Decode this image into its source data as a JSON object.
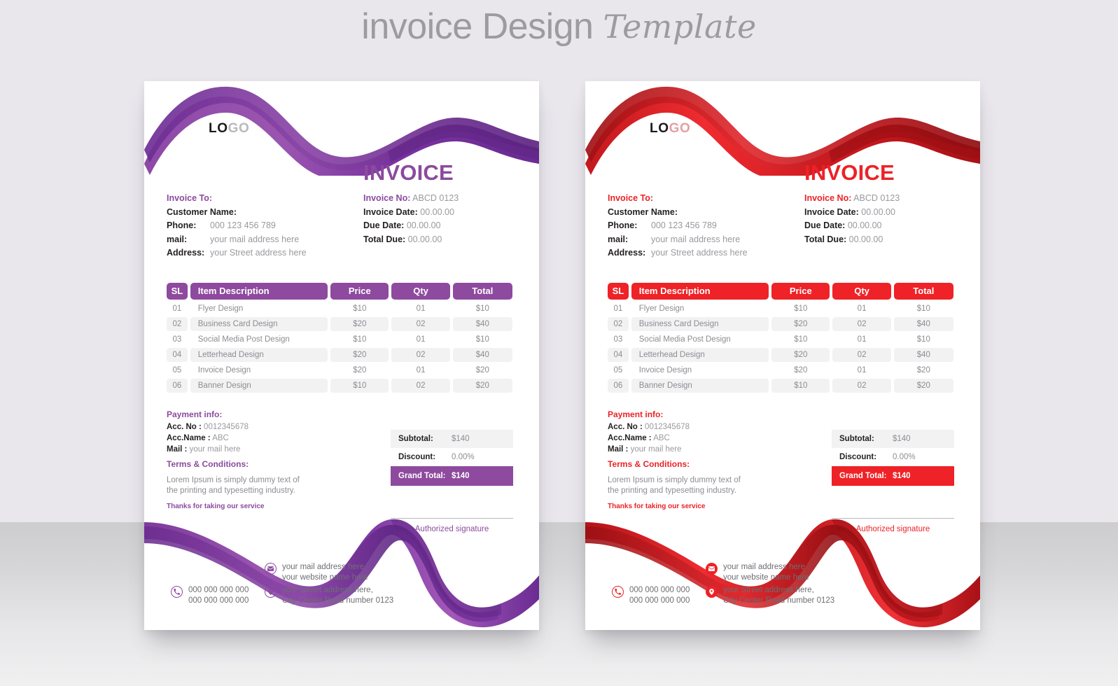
{
  "headline": {
    "main": "invoice Design",
    "script": "Template"
  },
  "colors": {
    "purple_accent": "#8b4a9e",
    "purple_dark": "#6b2d8f",
    "purple_light": "#a359b5",
    "red_accent": "#ec2227",
    "red_dark": "#b01217",
    "red_light": "#e8353b",
    "page_bg_top": "#e9e7ec",
    "page_bg_bottom": "#cdcdcf",
    "row_alt": "#f2f2f3",
    "muted_text": "#8d8d93",
    "dark_text": "#231f20"
  },
  "invoice": {
    "logo": {
      "part1": "LO",
      "part2": "GO"
    },
    "title": "INVOICE",
    "bill_to": {
      "heading": "Invoice To:",
      "customer_label": "Customer Name:",
      "rows": [
        {
          "label": "Phone:",
          "value": "000 123 456 789"
        },
        {
          "label": "mail:",
          "value": "your mail address here"
        },
        {
          "label": "Address:",
          "value": "your Street address here"
        }
      ]
    },
    "meta": [
      {
        "label": "Invoice No:",
        "value": "ABCD 0123"
      },
      {
        "label": "Invoice Date:",
        "value": "00.00.00"
      },
      {
        "label": "Due Date:",
        "value": "00.00.00"
      },
      {
        "label": "Total Due:",
        "value": "00.00.00"
      }
    ],
    "table": {
      "headers": [
        "SL",
        "Item Description",
        "Price",
        "Qty",
        "Total"
      ],
      "rows": [
        {
          "sl": "01",
          "desc": "Flyer Design",
          "price": "$10",
          "qty": "01",
          "total": "$10"
        },
        {
          "sl": "02",
          "desc": "Business Card Design",
          "price": "$20",
          "qty": "02",
          "total": "$40"
        },
        {
          "sl": "03",
          "desc": "Social Media Post Design",
          "price": "$10",
          "qty": "01",
          "total": "$10"
        },
        {
          "sl": "04",
          "desc": "Letterhead Design",
          "price": "$20",
          "qty": "02",
          "total": "$40"
        },
        {
          "sl": "05",
          "desc": "Invoice Design",
          "price": "$20",
          "qty": "01",
          "total": "$20"
        },
        {
          "sl": "06",
          "desc": "Banner Design",
          "price": "$10",
          "qty": "02",
          "total": "$20"
        }
      ]
    },
    "payment_info": {
      "heading": "Payment info:",
      "acc_no_label": "Acc. No :",
      "acc_no_value": "0012345678",
      "acc_name_label": "Acc.Name :",
      "acc_name_value": "ABC",
      "mail_label": "Mail :",
      "mail_value": "your mail here"
    },
    "terms": {
      "heading": "Terms & Conditions:",
      "body_line1": "Lorem Ipsum is simply dummy text of",
      "body_line2": "the printing and typesetting industry."
    },
    "thanks": "Thanks for taking our service",
    "totals": [
      {
        "key": "Subtotal:",
        "value": "$140"
      },
      {
        "key": "Discount:",
        "value": "0.00%"
      },
      {
        "key": "Grand Total:",
        "value": "$140"
      }
    ],
    "signature_caption": "Authorized signature",
    "contacts": {
      "phone": {
        "icon": "phone-icon",
        "line1": "000 000 000 000",
        "line2": "000 000 000 000"
      },
      "mail": {
        "icon": "envelope-icon",
        "line1": "your mail address here",
        "line2": "your website name here"
      },
      "address": {
        "icon": "location-pin-icon",
        "line1": "your Street address here,",
        "line2": "City Center Road number 0123"
      }
    }
  }
}
